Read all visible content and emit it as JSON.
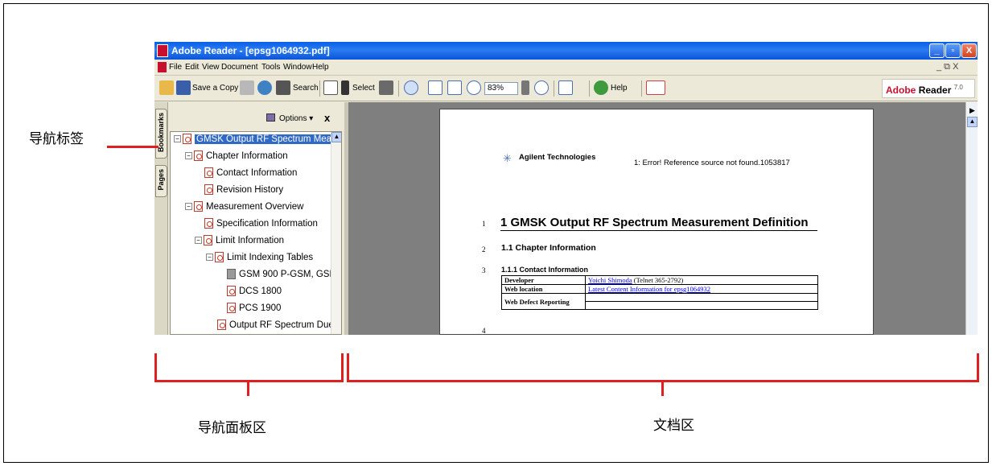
{
  "window": {
    "title": "Adobe Reader - [epsg1064932.pdf]",
    "buttons": [
      "_",
      "▫",
      "X"
    ]
  },
  "menu": {
    "items": [
      "File",
      "Edit",
      "View",
      "Document",
      "Tools",
      "Window",
      "Help"
    ],
    "doc_controls": "_ ⧉ X"
  },
  "toolbar": {
    "save_copy": "Save a Copy",
    "search": "Search",
    "select": "Select",
    "zoom": "83%",
    "help": "Help",
    "brand": "Adobe",
    "brand_product": "Reader",
    "brand_version": "7.0"
  },
  "navpanel": {
    "tabs": [
      "Bookmarks",
      "Pages"
    ],
    "options_label": "Options",
    "close": "x",
    "tree": [
      "GMSK Output RF Spectrum Measu",
      "Chapter Information",
      "Contact Information",
      "Revision History",
      "Measurement Overview",
      "Specification Information",
      "Limit Information",
      "Limit Indexing Tables",
      "GSM 900 P-GSM, GSM",
      "DCS 1800",
      "PCS 1900",
      "Output RF Spectrum Due t"
    ]
  },
  "document": {
    "company": "Agilent Technologies",
    "header_ref": "1: Error! Reference source not found.1053817",
    "line_numbers": [
      "1",
      "2",
      "3",
      "4"
    ],
    "h1": "1   GMSK Output RF Spectrum Measurement Definition",
    "h2": "1.1   Chapter Information",
    "h3": "1.1.1   Contact Information",
    "table": [
      {
        "key": "Developer",
        "link": "Yoichi Shimoda",
        "extra": " (Telnet 365-2792)"
      },
      {
        "key": "Web location",
        "link": "Latest Content Information for epsg1064932",
        "extra": ""
      },
      {
        "key": "Web Defect Reporting",
        "link": "",
        "extra": ""
      }
    ]
  },
  "annotations": {
    "nav_tab": "导航标签",
    "nav_panel": "导航面板区",
    "doc_area": "文档区"
  },
  "colors": {
    "annotation_red": "#e02020",
    "titlebar_blue": "#0a5fe6",
    "selection_blue": "#316ac5"
  }
}
